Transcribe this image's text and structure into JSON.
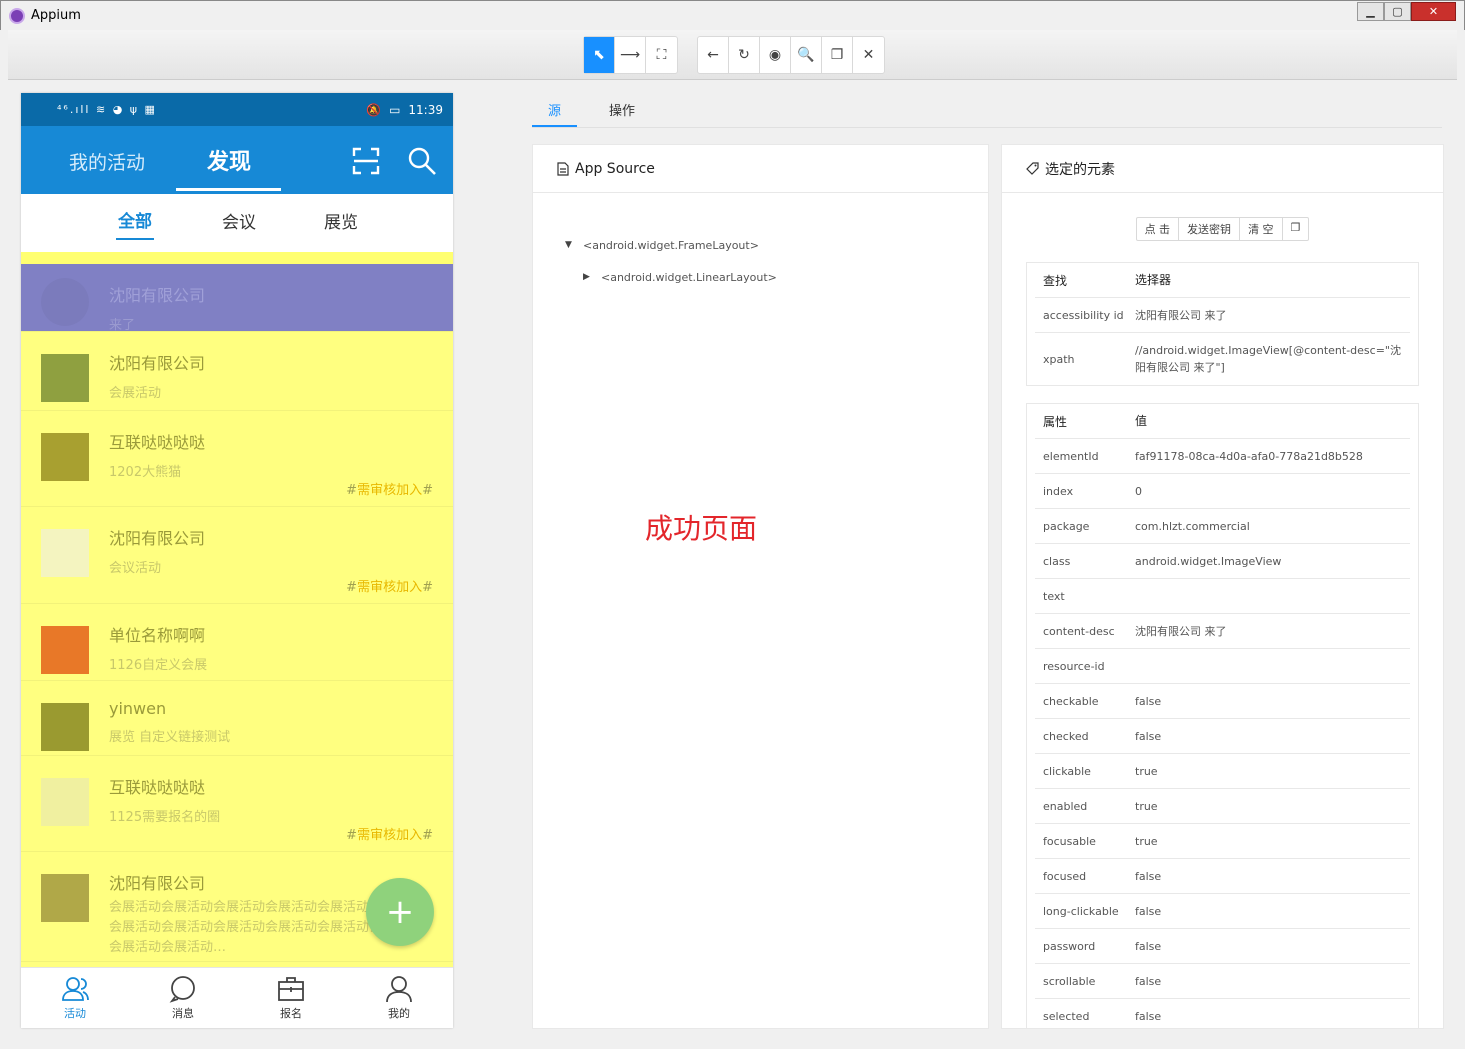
{
  "window": {
    "title": "Appium",
    "min": "▁",
    "max": "▢",
    "close": "✕"
  },
  "toolbar": {
    "left": [
      {
        "name": "select-element-button",
        "icon": "⬉",
        "active": true
      },
      {
        "name": "swipe-button",
        "icon": "⟶"
      },
      {
        "name": "tap-by-coordinates-button",
        "icon": "⛶"
      }
    ],
    "right": [
      {
        "name": "back-button",
        "icon": "←"
      },
      {
        "name": "refresh-button",
        "icon": "↻"
      },
      {
        "name": "start-recording-button",
        "icon": "◉"
      },
      {
        "name": "search-element-button",
        "icon": "🔍"
      },
      {
        "name": "copy-xml-button",
        "icon": "❐"
      },
      {
        "name": "quit-session-button",
        "icon": "✕"
      }
    ]
  },
  "phone": {
    "status": {
      "left": "⁴⁶.ıll ≋ ◕ ψ ▦",
      "mute": "🔕",
      "battery": "▭",
      "time": "11:39"
    },
    "header": {
      "tab1": "我的活动",
      "tab2": "发现"
    },
    "subtabs": [
      "全部",
      "会议",
      "展览"
    ],
    "items": [
      {
        "title": "沈阳有限公司",
        "sub": "来了",
        "tag": "",
        "selected": true,
        "thumb": "#7878b8"
      },
      {
        "title": "沈阳有限公司",
        "sub": "会展活动",
        "tag": "",
        "thumb": "#8fa040"
      },
      {
        "title": "互联哒哒哒哒",
        "sub": "1202大熊猫",
        "tag": "需审核加入",
        "thumb": "#a8a030"
      },
      {
        "title": "沈阳有限公司",
        "sub": "会议活动",
        "tag": "需审核加入",
        "thumb": "#f4f4c0"
      },
      {
        "title": "单位名称啊啊",
        "sub": "1126自定义会展",
        "tag": "",
        "thumb": "#e87828"
      },
      {
        "title": "yinwen",
        "sub": "展览 自定义链接测试",
        "tag": "",
        "thumb": "#9a9a30"
      },
      {
        "title": "互联哒哒哒哒",
        "sub": "1125需要报名的圈",
        "tag": "需审核加入",
        "thumb": "#f0f0a0"
      },
      {
        "title": "沈阳有限公司",
        "sub": "会展活动会展活动会展活动会展活动会展活动会展活动会展活动会展活动会展活动会展活动会展活动会展活动会展活动会展活动…",
        "tag": "",
        "thumb": "#b0a848"
      }
    ],
    "fab": "+",
    "nav": [
      "活动",
      "消息",
      "报名",
      "我的"
    ]
  },
  "tabs": {
    "source": "源",
    "actions": "操作"
  },
  "source": {
    "title": "App Source",
    "node1": "<android.widget.FrameLayout>",
    "node2": "<android.widget.LinearLayout>",
    "success": "成功页面"
  },
  "selected": {
    "title": "选定的元素",
    "buttons": [
      "点 击",
      "发送密钥",
      "清 空",
      "❐"
    ],
    "find_head": [
      "查找",
      "选择器"
    ],
    "find_rows": [
      [
        "accessibility id",
        "沈阳有限公司 来了"
      ],
      [
        "xpath",
        "//android.widget.ImageView[@content-desc=\"沈阳有限公司 来了\"]"
      ]
    ],
    "attr_head": [
      "属性",
      "值"
    ],
    "attr_rows": [
      [
        "elementId",
        "faf91178-08ca-4d0a-afa0-778a21d8b528"
      ],
      [
        "index",
        "0"
      ],
      [
        "package",
        "com.hlzt.commercial"
      ],
      [
        "class",
        "android.widget.ImageView"
      ],
      [
        "text",
        ""
      ],
      [
        "content-desc",
        "沈阳有限公司 来了"
      ],
      [
        "resource-id",
        ""
      ],
      [
        "checkable",
        "false"
      ],
      [
        "checked",
        "false"
      ],
      [
        "clickable",
        "true"
      ],
      [
        "enabled",
        "true"
      ],
      [
        "focusable",
        "true"
      ],
      [
        "focused",
        "false"
      ],
      [
        "long-clickable",
        "false"
      ],
      [
        "password",
        "false"
      ],
      [
        "scrollable",
        "false"
      ],
      [
        "selected",
        "false"
      ]
    ]
  }
}
